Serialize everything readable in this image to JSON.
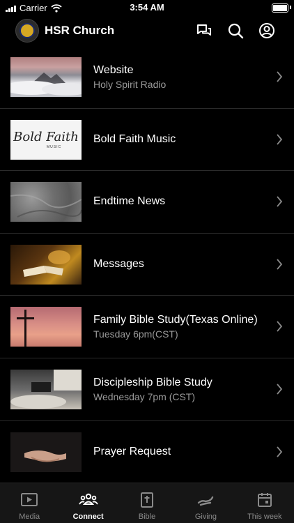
{
  "status_bar": {
    "carrier": "Carrier",
    "time": "3:54 AM"
  },
  "header": {
    "title": "HSR Church"
  },
  "items": [
    {
      "title": "Website",
      "subtitle": "Holy Spirit Radio"
    },
    {
      "title": "Bold Faith Music",
      "subtitle": "",
      "thumb_text": "Bold Faith",
      "thumb_subtext": "MUSIC"
    },
    {
      "title": "Endtime News",
      "subtitle": ""
    },
    {
      "title": "Messages",
      "subtitle": ""
    },
    {
      "title": "Family Bible Study(Texas Online)",
      "subtitle": "Tuesday 6pm(CST)"
    },
    {
      "title": "Discipleship Bible Study",
      "subtitle": "Wednesday 7pm (CST)"
    },
    {
      "title": "Prayer Request",
      "subtitle": ""
    }
  ],
  "tabs": [
    {
      "label": "Media",
      "icon": "play-icon",
      "active": false
    },
    {
      "label": "Connect",
      "icon": "group-icon",
      "active": true
    },
    {
      "label": "Bible",
      "icon": "bible-icon",
      "active": false
    },
    {
      "label": "Giving",
      "icon": "giving-icon",
      "active": false
    },
    {
      "label": "This week",
      "icon": "calendar-icon",
      "active": false
    }
  ]
}
